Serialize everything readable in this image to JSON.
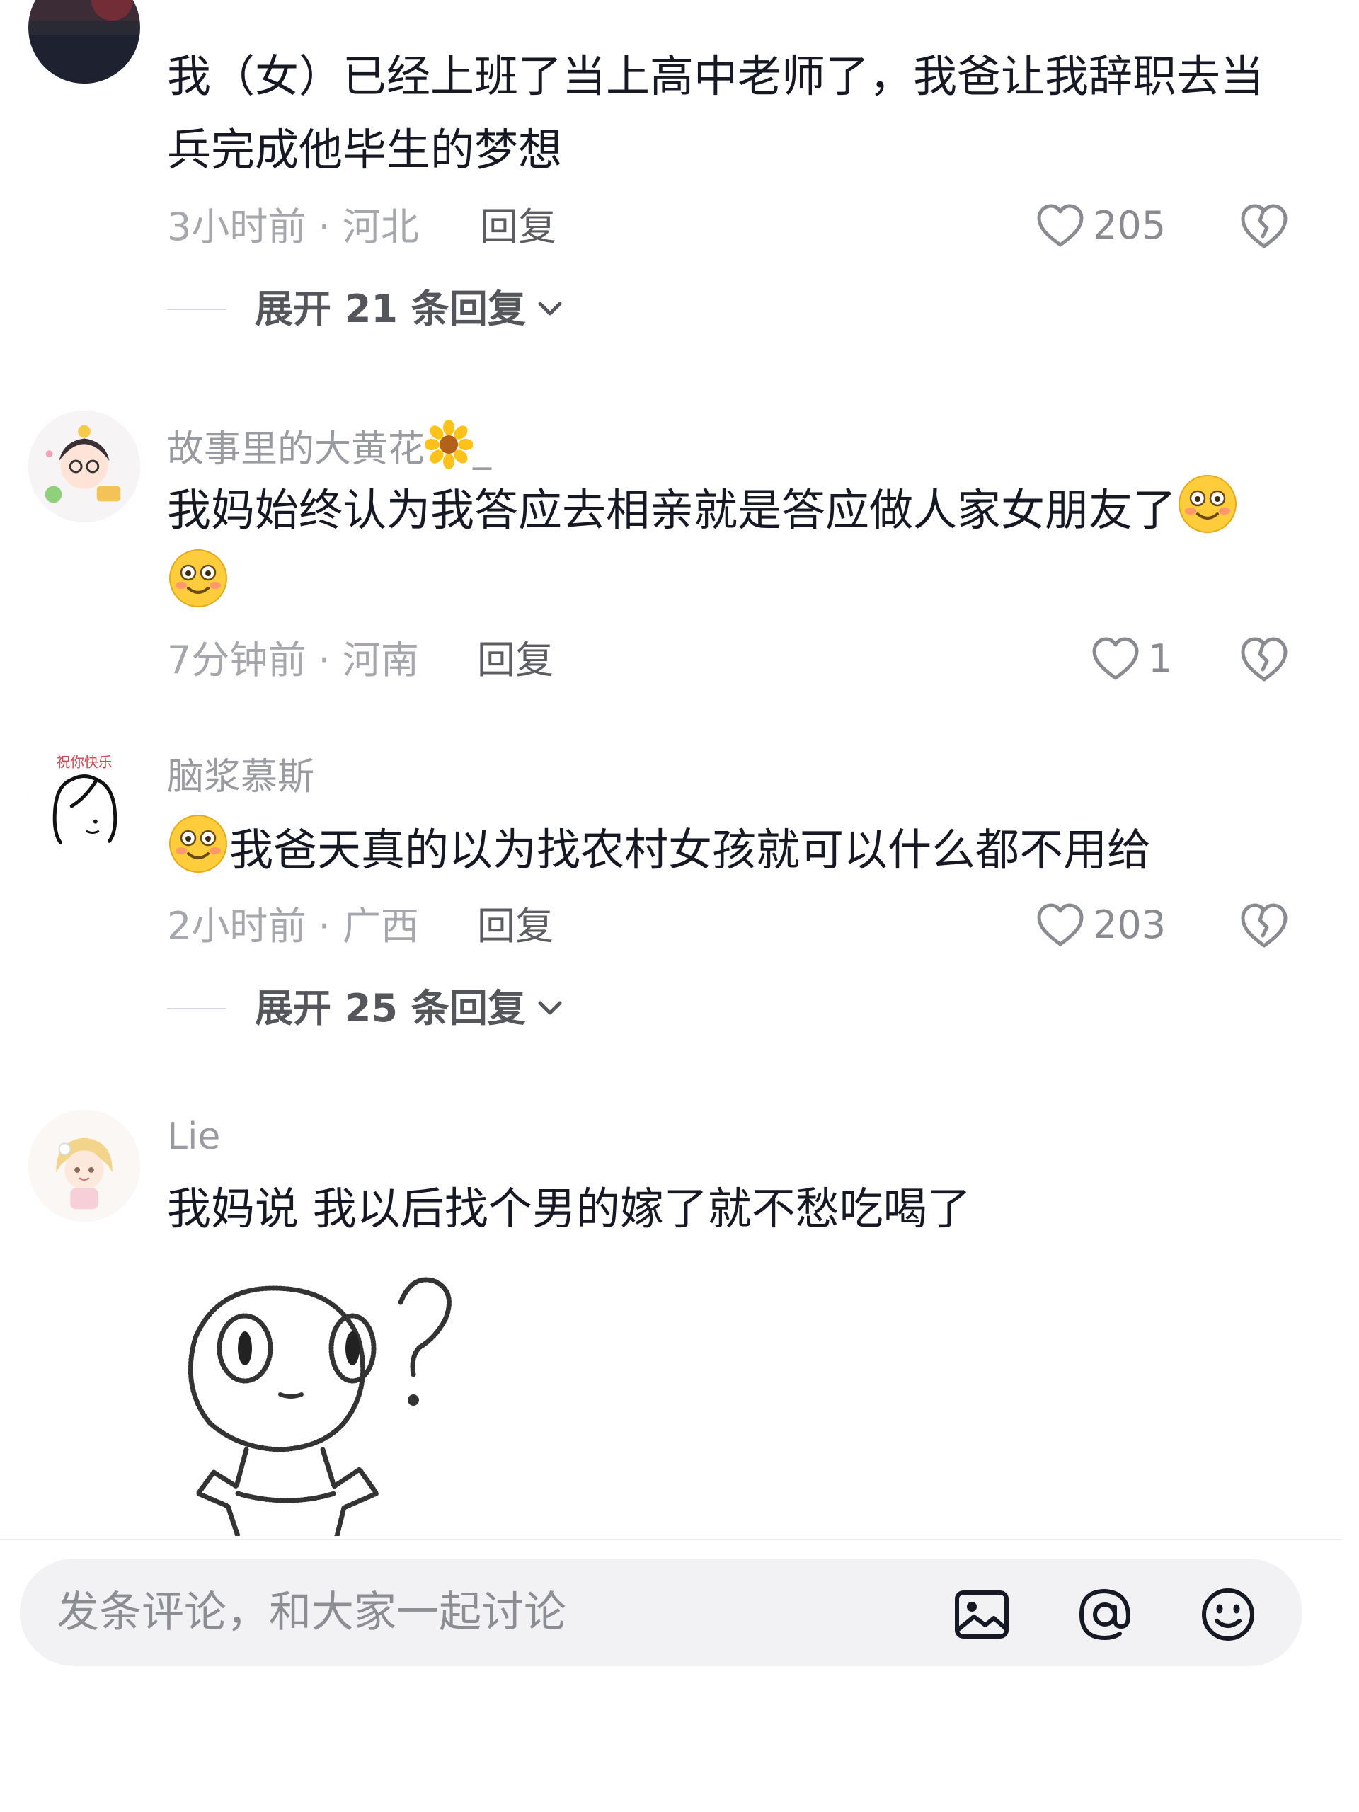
{
  "comments": [
    {
      "username": "",
      "text": "我（女）已经上班了当上高中老师了，我爸让我辞职去当兵完成他毕生的梦想",
      "time": "3小时前",
      "location": "河北",
      "reply_label": "回复",
      "likes": "205",
      "expand_label": "展开 21 条回复"
    },
    {
      "username": "故事里的大黄花",
      "username_suffix": "_",
      "text": "我妈始终认为我答应去相亲就是答应做人家女朋友了",
      "time": "7分钟前",
      "location": "河南",
      "reply_label": "回复",
      "likes": "1"
    },
    {
      "username": "脑浆慕斯",
      "avatar_text": "祝你快乐",
      "text": "我爸天真的以为找农村女孩就可以什么都不用给",
      "time": "2小时前",
      "location": "广西",
      "reply_label": "回复",
      "likes": "203",
      "expand_label": "展开 25 条回复"
    },
    {
      "username": "Lie",
      "text": "我妈说 我以后找个男的嫁了就不愁吃喝了"
    }
  ],
  "meta_separator": "·",
  "input_bar": {
    "placeholder": "发条评论，和大家一起讨论"
  },
  "icons": {
    "like": "heart-outline-icon",
    "dislike": "broken-heart-icon",
    "expand": "chevron-down-icon",
    "emoji": "flushed-smile-emoji",
    "image": "image-icon",
    "mention": "at-sign-icon",
    "emoji_picker": "smiley-face-icon",
    "flower": "sunflower-emoji"
  },
  "colors": {
    "text_primary": "#161823",
    "text_secondary": "#9a9ba1",
    "input_bg": "#f2f2f4",
    "emoji_yellow": "#ffcd3c"
  }
}
